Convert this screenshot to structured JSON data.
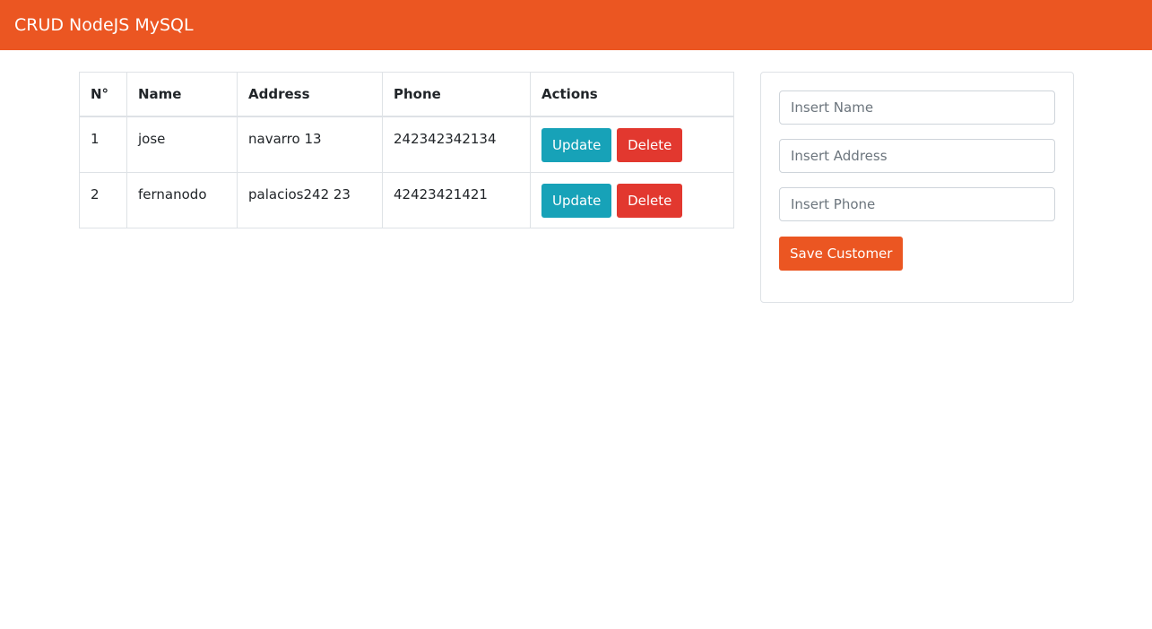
{
  "navbar": {
    "brand": "CRUD NodeJS MySQL",
    "color": "#eb5622"
  },
  "table": {
    "headers": [
      "N°",
      "Name",
      "Address",
      "Phone",
      "Actions"
    ],
    "rows": [
      {
        "n": "1",
        "name": "jose",
        "address": "navarro 13",
        "phone": "242342342134"
      },
      {
        "n": "2",
        "name": "fernanodo",
        "address": "palacios242 23",
        "phone": "42423421421"
      }
    ],
    "update_label": "Update",
    "delete_label": "Delete"
  },
  "form": {
    "name_placeholder": "Insert Name",
    "name_value": "",
    "address_placeholder": "Insert Address",
    "address_value": "",
    "phone_placeholder": "Insert Phone",
    "phone_value": "",
    "save_label": "Save Customer"
  },
  "colors": {
    "update": "#17a2b8",
    "delete": "#e2382f",
    "primary": "#eb5622"
  }
}
